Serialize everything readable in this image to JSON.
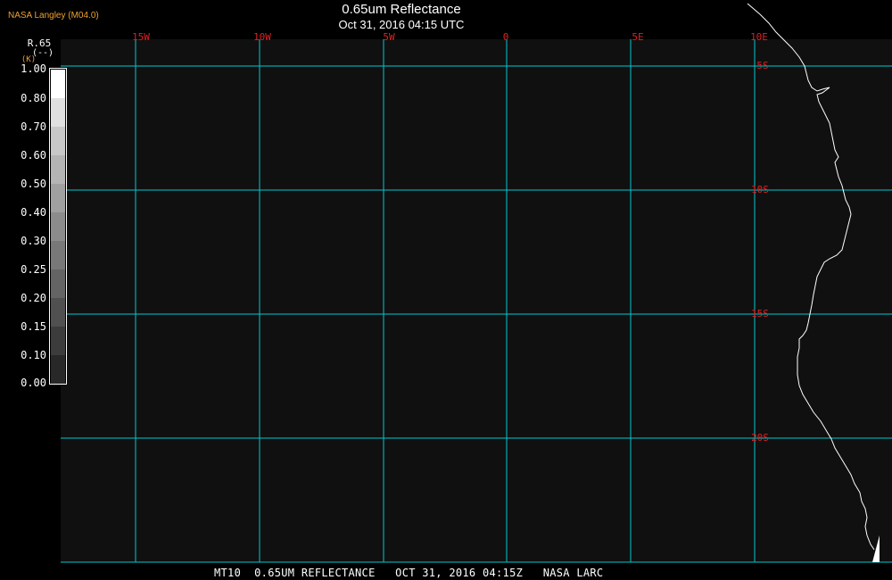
{
  "header": {
    "credit": "NASA Langley (M04.0)",
    "title": "0.65um Reflectance",
    "subtitle": "Oct 31, 2016 04:15 UTC"
  },
  "footer": {
    "caption": "MT10  0.65UM REFLECTANCE   OCT 31, 2016 04:15Z   NASA LARC"
  },
  "colorbar": {
    "variable": "R.65",
    "units_line1": "(--)",
    "units_line2": "(K)",
    "labels": [
      "1.00",
      "0.80",
      "0.70",
      "0.60",
      "0.50",
      "0.40",
      "0.30",
      "0.25",
      "0.20",
      "0.15",
      "0.10",
      "0.00"
    ],
    "colors": [
      "#ffffff",
      "#e0e0e0",
      "#c8c8c8",
      "#b4b4b4",
      "#a0a0a0",
      "#8c8c8c",
      "#787878",
      "#646464",
      "#505050",
      "#3c3c3c",
      "#282828"
    ]
  },
  "map": {
    "longitude_labels": [
      "15W",
      "10W",
      "5W",
      "0",
      "5E",
      "10E"
    ],
    "latitude_labels": [
      "5S",
      "10S",
      "15S",
      "20S"
    ],
    "gridline_color": "#00c8d0",
    "label_color": "#e02020",
    "background_color": "#101010",
    "coastline_color": "#ffffff"
  }
}
